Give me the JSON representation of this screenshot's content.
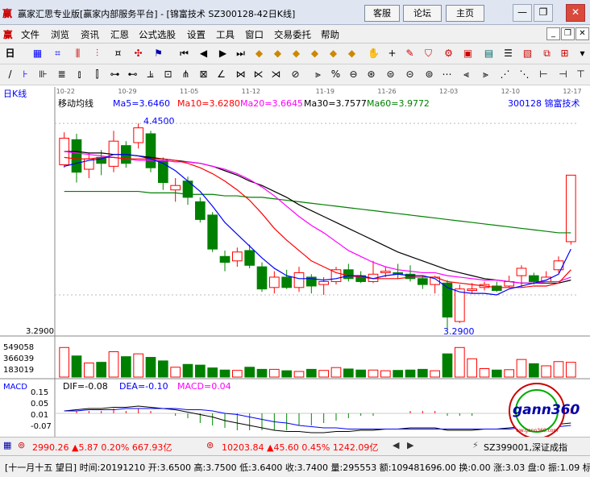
{
  "window": {
    "title": "赢家汇思专业版[赢家内部服务平台] - [锦富技术   SZ300128-42日K线]",
    "nav_buttons": [
      "客服",
      "论坛",
      "主页"
    ],
    "controls": [
      "—",
      "❐",
      "✕"
    ]
  },
  "menu": {
    "items": [
      "文件",
      "浏览",
      "资讯",
      "汇恩",
      "公式选股",
      "设置",
      "工具",
      "窗口",
      "交易委托",
      "帮助"
    ]
  },
  "chart_header": {
    "period": "日K线",
    "indicator_name": "移动均线",
    "ma5": "Ma5=3.6460",
    "ma10": "Ma10=3.6280",
    "ma20": "Ma20=3.6645",
    "ma30": "Ma30=3.7577",
    "ma60": "Ma60=3.9772",
    "stock": "300128  锦富技术",
    "high_label": "4.4500",
    "low_label": "3.2900",
    "left_low": "3.2900",
    "dates": [
      "10-22",
      "10-29",
      "11-05",
      "11-12",
      "11-19",
      "11-26",
      "12-03",
      "12-10",
      "12-17"
    ]
  },
  "volume_axis": [
    "549058",
    "366039",
    "183019"
  ],
  "macd": {
    "name": "MACD",
    "dif": "DIF=-0.08",
    "dea": "DEA=-0.10",
    "macd": "MACD=0.04",
    "axis": [
      "0.15",
      "0.05",
      "0.01",
      "-0.07"
    ]
  },
  "statusbar": {
    "sh": "2990.26 ▲5.87 0.20% 667.93亿",
    "sz": "10203.84 ▲45.60 0.45% 1242.09亿",
    "ticker": "SZ399001,深证成指"
  },
  "bottom": {
    "text": "[十一月十五  望日] 时间:20191210 开:3.6500 高:3.7500 低:3.6400 收:3.7400 量:295553 额:109481696.00 换:0.00 涨:3.03 盘:0 振:1.09 标:3"
  },
  "watermark": {
    "text": "gann360",
    "circle_text": "ww.gann360.com"
  },
  "chart_data": {
    "type": "candlestick",
    "candles": [
      {
        "o": 4.17,
        "c": 4.35,
        "h": 4.39,
        "l": 4.15
      },
      {
        "o": 4.34,
        "c": 4.12,
        "h": 4.38,
        "l": 4.05
      },
      {
        "o": 4.14,
        "c": 4.21,
        "h": 4.25,
        "l": 4.08
      },
      {
        "o": 4.22,
        "c": 4.18,
        "h": 4.27,
        "l": 4.1
      },
      {
        "o": 4.16,
        "c": 4.33,
        "h": 4.4,
        "l": 4.12
      },
      {
        "o": 4.3,
        "c": 4.18,
        "h": 4.33,
        "l": 4.15
      },
      {
        "o": 4.32,
        "c": 4.42,
        "h": 4.45,
        "l": 4.28
      },
      {
        "o": 4.38,
        "c": 4.15,
        "h": 4.4,
        "l": 4.12
      },
      {
        "o": 4.2,
        "c": 4.05,
        "h": 4.22,
        "l": 4.0
      },
      {
        "o": 4.0,
        "c": 4.03,
        "h": 4.08,
        "l": 3.92
      },
      {
        "o": 4.06,
        "c": 3.95,
        "h": 4.09,
        "l": 3.9
      },
      {
        "o": 3.92,
        "c": 3.8,
        "h": 3.95,
        "l": 3.78
      },
      {
        "o": 3.83,
        "c": 3.6,
        "h": 3.85,
        "l": 3.58
      },
      {
        "o": 3.55,
        "c": 3.51,
        "h": 3.59,
        "l": 3.45
      },
      {
        "o": 3.52,
        "c": 3.58,
        "h": 3.61,
        "l": 3.48
      },
      {
        "o": 3.59,
        "c": 3.49,
        "h": 3.63,
        "l": 3.47
      },
      {
        "o": 3.48,
        "c": 3.33,
        "h": 3.51,
        "l": 3.31
      },
      {
        "o": 3.34,
        "c": 3.41,
        "h": 3.45,
        "l": 3.3
      },
      {
        "o": 3.41,
        "c": 3.34,
        "h": 3.46,
        "l": 3.33
      },
      {
        "o": 3.34,
        "c": 3.44,
        "h": 3.48,
        "l": 3.31
      },
      {
        "o": 3.41,
        "c": 3.35,
        "h": 3.43,
        "l": 3.3
      },
      {
        "o": 3.36,
        "c": 3.38,
        "h": 3.41,
        "l": 3.29
      },
      {
        "o": 3.38,
        "c": 3.46,
        "h": 3.48,
        "l": 3.36
      },
      {
        "o": 3.46,
        "c": 3.4,
        "h": 3.5,
        "l": 3.38
      },
      {
        "o": 3.42,
        "c": 3.38,
        "h": 3.45,
        "l": 3.37
      },
      {
        "o": 3.38,
        "c": 3.43,
        "h": 3.52,
        "l": 3.37
      },
      {
        "o": 3.44,
        "c": 3.45,
        "h": 3.48,
        "l": 3.41
      },
      {
        "o": 3.44,
        "c": 3.43,
        "h": 3.5,
        "l": 3.4
      },
      {
        "o": 3.43,
        "c": 3.4,
        "h": 3.49,
        "l": 3.38
      },
      {
        "o": 3.4,
        "c": 3.36,
        "h": 3.42,
        "l": 3.33
      },
      {
        "o": 3.36,
        "c": 3.41,
        "h": 3.42,
        "l": 3.3
      },
      {
        "o": 3.37,
        "c": 3.14,
        "h": 3.39,
        "l": 3.05
      },
      {
        "o": 3.11,
        "c": 3.33,
        "h": 3.36,
        "l": 3.1
      },
      {
        "o": 3.32,
        "c": 3.33,
        "h": 3.37,
        "l": 3.3
      },
      {
        "o": 3.34,
        "c": 3.36,
        "h": 3.38,
        "l": 3.32
      },
      {
        "o": 3.35,
        "c": 3.32,
        "h": 3.38,
        "l": 3.31
      },
      {
        "o": 3.35,
        "c": 3.38,
        "h": 3.42,
        "l": 3.34
      },
      {
        "o": 3.42,
        "c": 3.47,
        "h": 3.49,
        "l": 3.34
      },
      {
        "o": 3.42,
        "c": 3.38,
        "h": 3.44,
        "l": 3.36
      },
      {
        "o": 3.38,
        "c": 3.41,
        "h": 3.45,
        "l": 3.38
      },
      {
        "o": 3.46,
        "c": 3.52,
        "h": 3.55,
        "l": 3.44
      },
      {
        "o": 3.65,
        "c": 4.1,
        "h": 4.1,
        "l": 3.63
      }
    ],
    "volumes": [
      420000,
      300000,
      200000,
      210000,
      360000,
      290000,
      330000,
      280000,
      230000,
      140000,
      180000,
      170000,
      130000,
      100000,
      95000,
      140000,
      110000,
      110000,
      90000,
      80000,
      110000,
      95000,
      135000,
      115000,
      100000,
      100000,
      90000,
      95000,
      100000,
      110000,
      90000,
      330000,
      420000,
      260000,
      120000,
      100000,
      105000,
      250000,
      190000,
      160000,
      220000,
      210000
    ],
    "ma5": [
      4.16,
      4.18,
      4.2,
      4.21,
      4.24,
      4.24,
      4.23,
      4.21,
      4.18,
      4.13,
      4.06,
      3.99,
      3.89,
      3.78,
      3.7,
      3.62,
      3.54,
      3.47,
      3.42,
      3.4,
      3.4,
      3.39,
      3.4,
      3.42,
      3.42,
      3.4,
      3.42,
      3.43,
      3.42,
      3.42,
      3.4,
      3.34,
      3.31,
      3.3,
      3.3,
      3.29,
      3.33,
      3.35,
      3.37,
      3.39,
      3.43,
      3.6
    ],
    "ma10": [
      4.22,
      4.21,
      4.21,
      4.22,
      4.22,
      4.21,
      4.21,
      4.21,
      4.21,
      4.2,
      4.18,
      4.15,
      4.11,
      4.06,
      4.0,
      3.93,
      3.84,
      3.74,
      3.66,
      3.59,
      3.52,
      3.48,
      3.44,
      3.42,
      3.41,
      3.4,
      3.4,
      3.4,
      3.41,
      3.41,
      3.41,
      3.38,
      3.37,
      3.36,
      3.35,
      3.34,
      3.34,
      3.34,
      3.35,
      3.35,
      3.37,
      3.46
    ],
    "ma20": [
      4.26,
      4.25,
      4.24,
      4.23,
      4.22,
      4.21,
      4.2,
      4.2,
      4.2,
      4.19,
      4.19,
      4.18,
      4.16,
      4.14,
      4.11,
      4.07,
      4.02,
      3.96,
      3.89,
      3.82,
      3.76,
      3.71,
      3.65,
      3.59,
      3.55,
      3.51,
      3.48,
      3.46,
      3.45,
      3.44,
      3.44,
      3.42,
      3.41,
      3.4,
      3.39,
      3.39,
      3.38,
      3.37,
      3.37,
      3.38,
      3.38,
      3.41
    ],
    "ma30": [
      4.26,
      4.26,
      4.25,
      4.25,
      4.24,
      4.24,
      4.23,
      4.22,
      4.21,
      4.2,
      4.19,
      4.18,
      4.16,
      4.13,
      4.1,
      4.06,
      4.03,
      3.99,
      3.95,
      3.9,
      3.86,
      3.82,
      3.78,
      3.74,
      3.7,
      3.66,
      3.62,
      3.58,
      3.55,
      3.52,
      3.49,
      3.46,
      3.44,
      3.42,
      3.4,
      3.39,
      3.38,
      3.37,
      3.37,
      3.37,
      3.37,
      3.39
    ],
    "ma60": [
      3.99,
      3.99,
      3.99,
      3.99,
      3.99,
      3.99,
      3.99,
      3.98,
      3.98,
      3.98,
      3.97,
      3.97,
      3.97,
      3.96,
      3.96,
      3.95,
      3.95,
      3.94,
      3.93,
      3.92,
      3.91,
      3.9,
      3.89,
      3.88,
      3.87,
      3.86,
      3.85,
      3.84,
      3.83,
      3.82,
      3.81,
      3.8,
      3.79,
      3.78,
      3.77,
      3.76,
      3.75,
      3.74,
      3.73,
      3.72,
      3.71,
      3.71
    ],
    "dif": [
      0.02,
      0.03,
      0.04,
      0.04,
      0.05,
      0.05,
      0.06,
      0.05,
      0.04,
      0.03,
      0.01,
      -0.01,
      -0.03,
      -0.06,
      -0.08,
      -0.1,
      -0.12,
      -0.14,
      -0.15,
      -0.15,
      -0.16,
      -0.16,
      -0.15,
      -0.15,
      -0.14,
      -0.14,
      -0.13,
      -0.13,
      -0.12,
      -0.12,
      -0.12,
      -0.14,
      -0.14,
      -0.14,
      -0.13,
      -0.13,
      -0.12,
      -0.11,
      -0.11,
      -0.1,
      -0.09,
      -0.08
    ],
    "dea": [
      0.02,
      0.02,
      0.03,
      0.03,
      0.03,
      0.04,
      0.04,
      0.04,
      0.04,
      0.04,
      0.03,
      0.03,
      0.02,
      0.0,
      -0.01,
      -0.03,
      -0.05,
      -0.07,
      -0.08,
      -0.1,
      -0.11,
      -0.12,
      -0.12,
      -0.13,
      -0.13,
      -0.13,
      -0.13,
      -0.13,
      -0.13,
      -0.13,
      -0.13,
      -0.13,
      -0.13,
      -0.13,
      -0.13,
      -0.13,
      -0.13,
      -0.12,
      -0.12,
      -0.12,
      -0.11,
      -0.1
    ],
    "ylim": [
      3.05,
      4.5
    ],
    "vol_max": 549058,
    "macd_lim": [
      -0.18,
      0.18
    ],
    "colors": {
      "up": "#ff0000",
      "down": "#008000",
      "ma5": "#0000ff",
      "ma10": "#ff0000",
      "ma20": "#ff00ff",
      "ma30": "#000000",
      "ma60": "#008000"
    }
  }
}
